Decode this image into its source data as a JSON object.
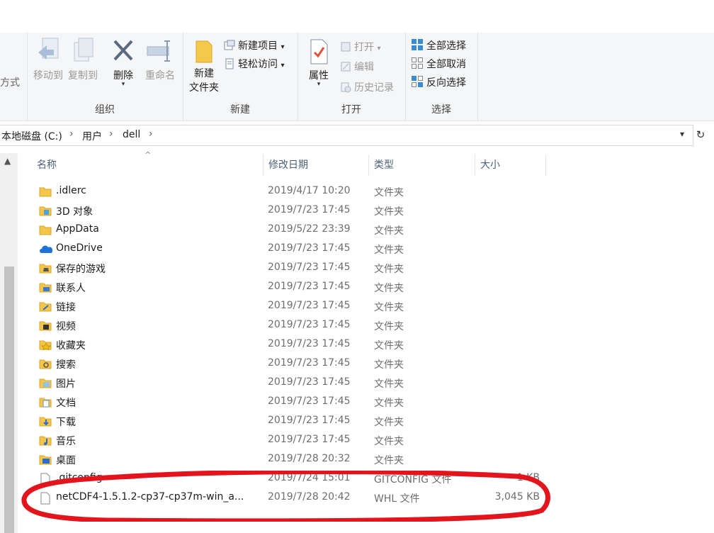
{
  "ribbon": {
    "partial_label": "方式",
    "organize": {
      "label": "组织",
      "move_to": "移动到",
      "copy_to": "复制到",
      "delete": "删除",
      "rename": "重命名"
    },
    "new": {
      "label": "新建",
      "new_folder_line1": "新建",
      "new_folder_line2": "文件夹",
      "new_item": "新建项目",
      "easy_access": "轻松访问"
    },
    "open": {
      "label": "打开",
      "properties": "属性",
      "open": "打开",
      "edit": "编辑",
      "history": "历史记录"
    },
    "select": {
      "label": "选择",
      "select_all": "全部选择",
      "select_none": "全部取消",
      "invert": "反向选择"
    }
  },
  "address": {
    "crumbs": [
      "本地磁盘 (C:)",
      "用户",
      "dell"
    ]
  },
  "columns": {
    "name": "名称",
    "date": "修改日期",
    "type": "类型",
    "size": "大小"
  },
  "rows": [
    {
      "name": ".idlerc",
      "date": "2019/4/17 10:20",
      "type": "文件夹",
      "size": "",
      "icon": "folder"
    },
    {
      "name": "3D 对象",
      "date": "2019/7/23 17:45",
      "type": "文件夹",
      "size": "",
      "icon": "3d-objects"
    },
    {
      "name": "AppData",
      "date": "2019/5/22 23:39",
      "type": "文件夹",
      "size": "",
      "icon": "folder"
    },
    {
      "name": "OneDrive",
      "date": "2019/7/23 17:45",
      "type": "文件夹",
      "size": "",
      "icon": "cloud"
    },
    {
      "name": "保存的游戏",
      "date": "2019/7/23 17:45",
      "type": "文件夹",
      "size": "",
      "icon": "saved-games"
    },
    {
      "name": "联系人",
      "date": "2019/7/23 17:45",
      "type": "文件夹",
      "size": "",
      "icon": "contacts"
    },
    {
      "name": "链接",
      "date": "2019/7/23 17:45",
      "type": "文件夹",
      "size": "",
      "icon": "links"
    },
    {
      "name": "视频",
      "date": "2019/7/23 17:45",
      "type": "文件夹",
      "size": "",
      "icon": "videos"
    },
    {
      "name": "收藏夹",
      "date": "2019/7/23 17:45",
      "type": "文件夹",
      "size": "",
      "icon": "favorites"
    },
    {
      "name": "搜索",
      "date": "2019/7/23 17:45",
      "type": "文件夹",
      "size": "",
      "icon": "searches"
    },
    {
      "name": "图片",
      "date": "2019/7/23 17:45",
      "type": "文件夹",
      "size": "",
      "icon": "pictures"
    },
    {
      "name": "文档",
      "date": "2019/7/23 17:45",
      "type": "文件夹",
      "size": "",
      "icon": "documents"
    },
    {
      "name": "下载",
      "date": "2019/7/23 17:45",
      "type": "文件夹",
      "size": "",
      "icon": "downloads"
    },
    {
      "name": "音乐",
      "date": "2019/7/23 17:45",
      "type": "文件夹",
      "size": "",
      "icon": "music"
    },
    {
      "name": "桌面",
      "date": "2019/7/28 20:32",
      "type": "文件夹",
      "size": "",
      "icon": "desktop"
    },
    {
      "name": ".gitconfig",
      "date": "2019/7/24 15:01",
      "type": "GITCONFIG 文件",
      "size": "1 KB",
      "icon": "file"
    },
    {
      "name": "netCDF4-1.5.1.2-cp37-cp37m-win_a...",
      "date": "2019/7/28 20:42",
      "type": "WHL 文件",
      "size": "3,045 KB",
      "icon": "file"
    }
  ]
}
